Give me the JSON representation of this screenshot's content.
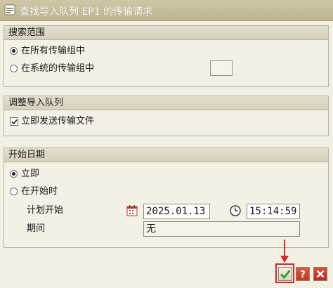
{
  "window": {
    "title": "查找导入队列 EP1 的传输请求"
  },
  "search_scope": {
    "header": "搜索范围",
    "options": [
      {
        "label": "在所有传输组中",
        "checked": true
      },
      {
        "label": "在系统的传输组中",
        "checked": false
      }
    ]
  },
  "adjust_queue": {
    "header": "调整导入队列",
    "checkbox_label": "立即发送传输文件",
    "checked": true
  },
  "start_date": {
    "header": "开始日期",
    "options": [
      {
        "label": "立即",
        "checked": true
      },
      {
        "label": "在开始时",
        "checked": false
      }
    ],
    "planned_start_label": "计划开始",
    "date_value": "2025.01.13",
    "time_value": "15:14:59",
    "period_label": "期间",
    "period_value": "无"
  },
  "icons": {
    "title": "window-menu-icon",
    "calendar": "calendar-icon",
    "clock": "clock-icon",
    "confirm": "check-icon",
    "help": "help-icon",
    "cancel": "cancel-icon"
  },
  "colors": {
    "background": "#f2efe3",
    "titlebar": "#c4bb98",
    "confirm_green": "#2f9e2f",
    "cancel_red": "#d0281c",
    "highlight_red": "#d22a2a"
  }
}
